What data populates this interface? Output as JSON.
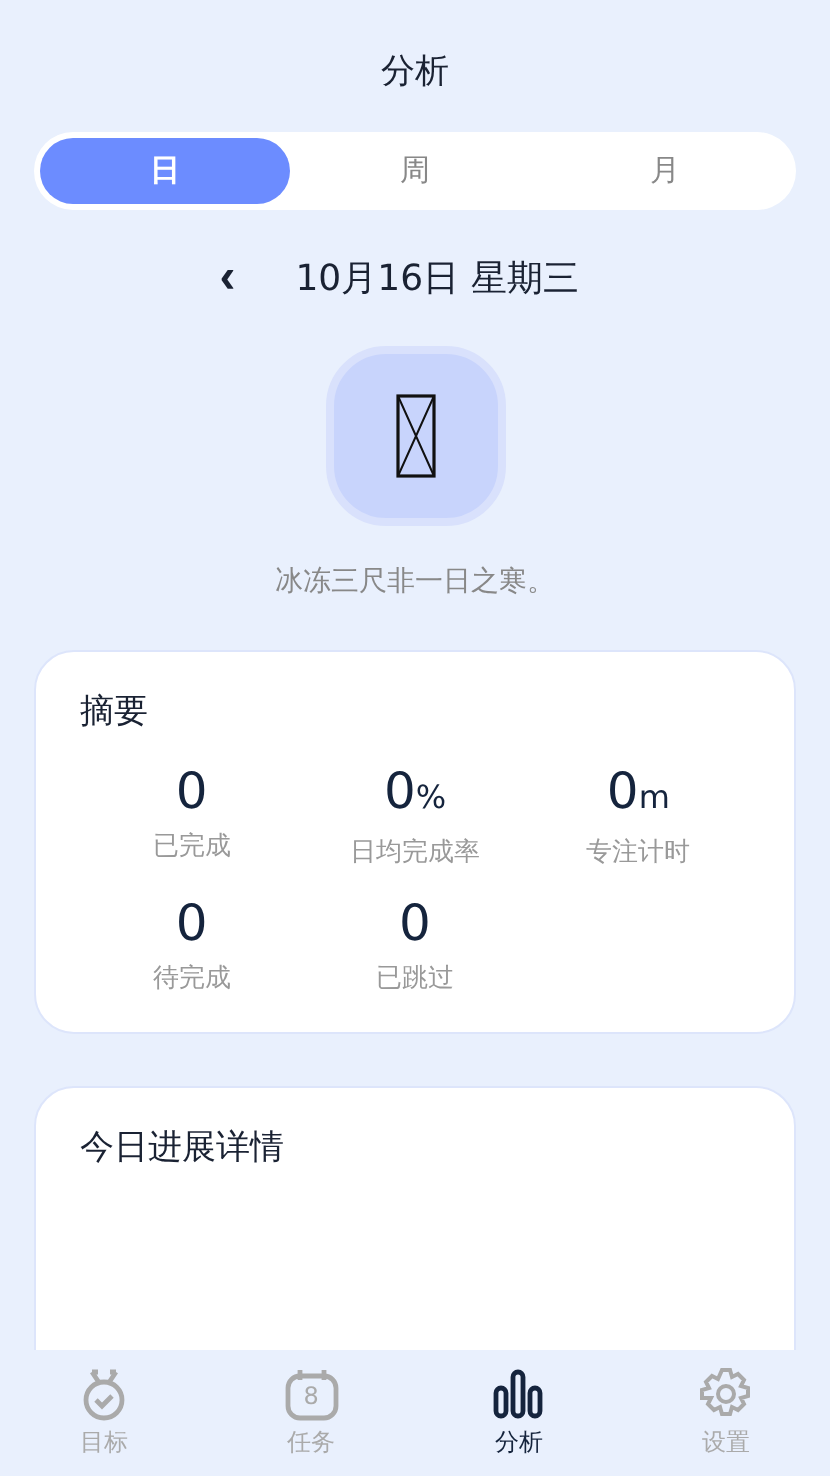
{
  "header": {
    "title": "分析"
  },
  "tabs": [
    {
      "label": "日",
      "selected": true
    },
    {
      "label": "周",
      "selected": false
    },
    {
      "label": "月",
      "selected": false
    }
  ],
  "date_nav": {
    "prev": "‹",
    "date": "10月16日 星期三"
  },
  "quote": "冰冻三尺非一日之寒。",
  "summary": {
    "title": "摘要",
    "stats": [
      {
        "value": "0",
        "label": "已完成"
      },
      {
        "value": "0",
        "unit": "%",
        "label": "日均完成率"
      },
      {
        "value": "0",
        "unit": "m",
        "label": "专注计时"
      },
      {
        "value": "0",
        "label": "待完成"
      },
      {
        "value": "0",
        "label": "已跳过"
      }
    ]
  },
  "details": {
    "title": "今日进展详情"
  },
  "bottom_nav": [
    {
      "kind": "medal",
      "label": "目标",
      "selected": false
    },
    {
      "kind": "calendar",
      "label": "任务",
      "badge": "8",
      "selected": false
    },
    {
      "kind": "chart",
      "label": "分析",
      "selected": true
    },
    {
      "kind": "gear",
      "label": "设置",
      "selected": false
    }
  ]
}
